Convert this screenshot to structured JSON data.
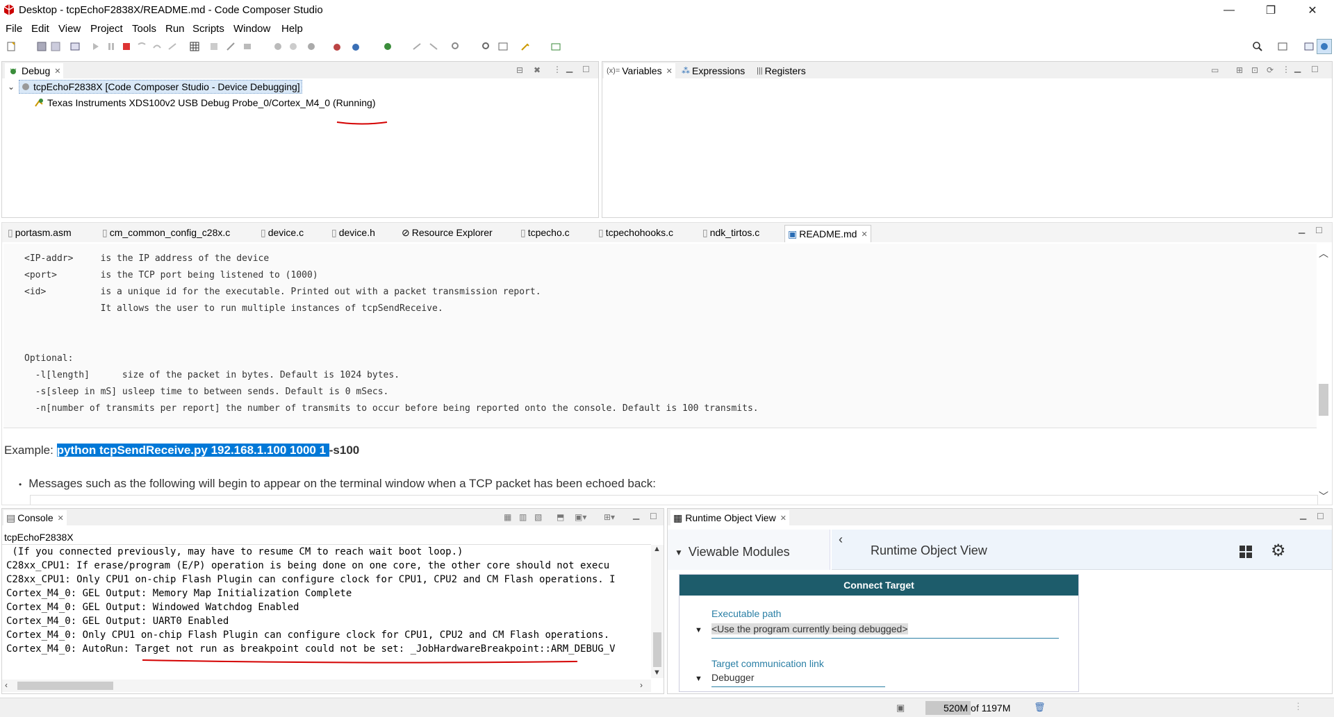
{
  "window": {
    "title": "Desktop - tcpEchoF2838X/README.md - Code Composer Studio",
    "minimize": "—",
    "restore": "❐",
    "close": "✕"
  },
  "menu": [
    "File",
    "Edit",
    "View",
    "Project",
    "Tools",
    "Run",
    "Scripts",
    "Window",
    "Help"
  ],
  "debug_view": {
    "tab": "Debug",
    "session": "tcpEchoF2838X [Code Composer Studio - Device Debugging]",
    "probe": "Texas Instruments XDS100v2 USB Debug Probe_0/Cortex_M4_0",
    "state": "(Running)"
  },
  "variables_view": {
    "tabs": [
      "Variables",
      "Expressions",
      "Registers"
    ]
  },
  "editor": {
    "tabs": [
      "portasm.asm",
      "cm_common_config_c28x.c",
      "device.c",
      "device.h",
      "Resource Explorer",
      "tcpecho.c",
      "tcpechohooks.c",
      "ndk_tirtos.c",
      "README.md"
    ],
    "active_tab": "README.md",
    "code_lines": [
      "<IP-addr>     is the IP address of the device",
      "<port>        is the TCP port being listened to (1000)",
      "<id>          is a unique id for the executable. Printed out with a packet transmission report.",
      "              It allows the user to run multiple instances of tcpSendReceive.",
      "",
      "",
      "",
      "Optional:",
      "  -l[length]      size of the packet in bytes. Default is 1024 bytes.",
      "  -s[sleep in mS] usleep time to between sends. Default is 0 mSecs.",
      "  -n[number of transmits per report] the number of transmits to occur before being reported onto the console. Default is 100 transmits."
    ],
    "example_label": "Example: ",
    "example_selected": "python tcpSendReceive.py 192.168.1.100 1000 1 ",
    "example_rest": "-s100",
    "bullet_text": "Messages such as the following will begin to appear on the terminal window when a TCP packet has been echoed back:"
  },
  "console": {
    "tab": "Console",
    "project": "tcpEchoF2838X",
    "lines": [
      " (If you connected previously, may have to resume CM to reach wait boot loop.)",
      "C28xx_CPU1: If erase/program (E/P) operation is being done on one core, the other core should not execu",
      "C28xx_CPU1: Only CPU1 on-chip Flash Plugin can configure clock for CPU1, CPU2 and CM Flash operations. I",
      "Cortex_M4_0: GEL Output: Memory Map Initialization Complete",
      "Cortex_M4_0: GEL Output: Windowed Watchdog Enabled",
      "Cortex_M4_0: GEL Output: UART0 Enabled",
      "Cortex_M4_0: Only CPU1 on-chip Flash Plugin can configure clock for CPU1, CPU2 and CM Flash operations.",
      "Cortex_M4_0: AutoRun: Target not run as breakpoint could not be set: _JobHardwareBreakpoint::ARM_DEBUG_V"
    ]
  },
  "runtime_view": {
    "tab": "Runtime Object View",
    "modules_label": "Viewable Modules",
    "header_title": "Runtime Object View",
    "connect_button": "Connect Target",
    "exec_label": "Executable path",
    "exec_value": "<Use the program currently being debugged>",
    "link_label": "Target communication link",
    "link_value": "Debugger"
  },
  "status": {
    "heap_used": "520M",
    "heap_total": " of 1197M"
  },
  "colors": {
    "selection": "#0078d7",
    "annotation": "#d40000",
    "connect_header": "#1d5c6b"
  }
}
